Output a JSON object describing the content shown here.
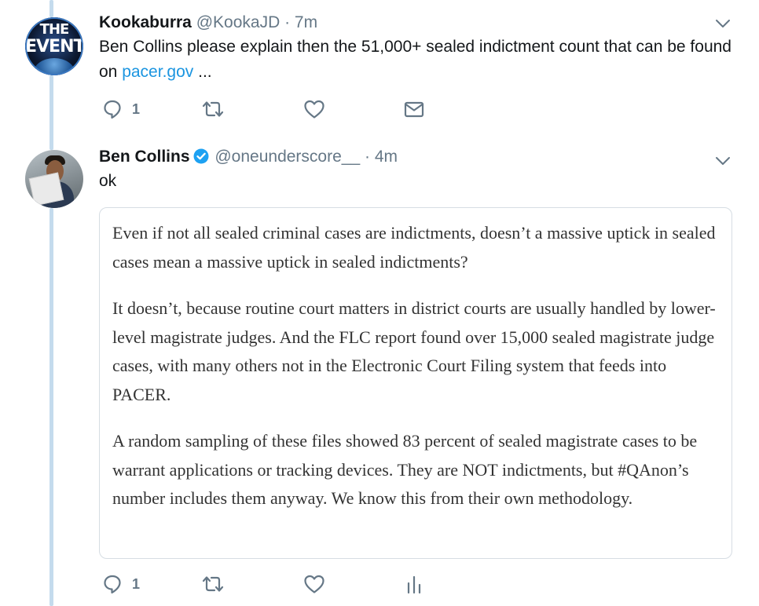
{
  "tweets": [
    {
      "avatar": {
        "text_line1": "THE",
        "text_line2": "EVENT"
      },
      "display_name": "Kookaburra",
      "handle": "@KookaJD",
      "separator": "·",
      "time": "7m",
      "text_before_link": "Ben Collins please explain then the 51,000+ sealed indictment count that can be found on ",
      "link_text": "pacer.gov",
      "text_after_link": " ...",
      "reply_count": "1",
      "icons": [
        "reply-icon",
        "retweet-icon",
        "like-icon",
        "direct-message-icon"
      ]
    },
    {
      "display_name": "Ben Collins",
      "verified": true,
      "handle": "@oneunderscore__",
      "separator": "·",
      "time": "4m",
      "text": "ok",
      "quote_paragraphs": [
        "Even if not all sealed criminal cases are indictments, doesn’t a massive uptick in sealed cases mean a massive uptick in sealed indictments?",
        "It doesn’t, because routine court matters in district courts are usually handled by lower-level magistrate judges. And the FLC report found over 15,000 sealed magistrate judge cases, with many others not in the Electronic Court Filing system that feeds into PACER.",
        "A random sampling of these files showed 83 percent of sealed magistrate cases to be warrant applications or tracking devices. They are NOT indictments, but #QAnon’s number includes them anyway. We know this from their own methodology."
      ],
      "reply_count": "1",
      "icons": [
        "reply-icon",
        "retweet-icon",
        "like-icon",
        "analytics-icon"
      ]
    }
  ],
  "colors": {
    "thread_line": "#c4dbed",
    "link": "#1b95e0",
    "secondary_text": "#657786",
    "verified_badge": "#1da1f2"
  }
}
